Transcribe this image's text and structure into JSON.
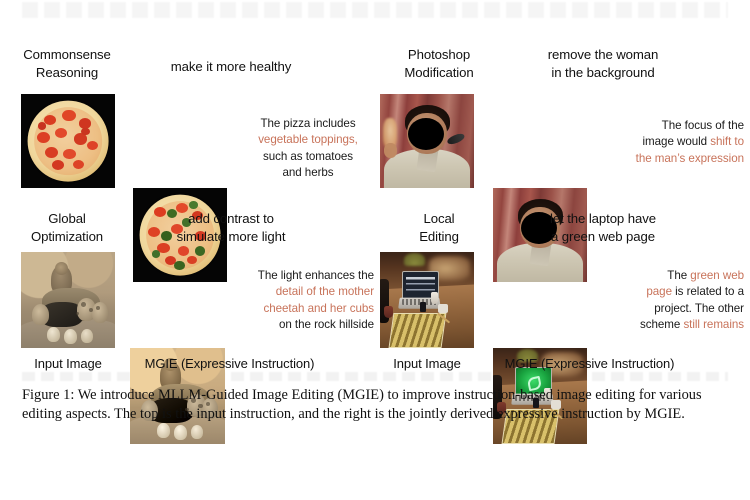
{
  "figure": {
    "panels": [
      {
        "id": "commonsense-reasoning",
        "category": "Commonsense\nReasoning",
        "category_line1": "Commonsense",
        "category_line2": "Reasoning",
        "instruction_line1": "make it more healthy",
        "instruction_line2": "",
        "explanation": [
          {
            "text": "The pizza includes",
            "highlight": false
          },
          {
            "text": "vegetable toppings,",
            "highlight": true
          },
          {
            "text": "such as tomatoes",
            "highlight": false
          },
          {
            "text": "and herbs",
            "highlight": false
          }
        ]
      },
      {
        "id": "photoshop-modification",
        "category_line1": "Photoshop",
        "category_line2": "Modification",
        "instruction_line1": "remove the woman",
        "instruction_line2": "in the background",
        "explanation": [
          {
            "text": "The focus of the",
            "highlight": false
          },
          {
            "text": "image would ",
            "highlight": false,
            "tail": "shift to",
            "tail_highlight": true
          },
          {
            "text": "the man’s expression",
            "highlight": true
          }
        ]
      },
      {
        "id": "global-optimization",
        "category_line1": "Global",
        "category_line2": "Optimization",
        "instruction_line1": "add contrast to",
        "instruction_line2": "simulate more light",
        "explanation": [
          {
            "text": "The light enhances the",
            "highlight": false
          },
          {
            "text": "detail of the mother",
            "highlight": true
          },
          {
            "text": "cheetah and her cubs",
            "highlight": true
          },
          {
            "text": "on the rock hillside",
            "highlight": false
          }
        ]
      },
      {
        "id": "local-editing",
        "category_line1": "Local",
        "category_line2": "Editing",
        "instruction_line1": "let the laptop have",
        "instruction_line2": "a green web page",
        "explanation": [
          {
            "text": "The ",
            "highlight": false,
            "tail": "green web",
            "tail_highlight": true
          },
          {
            "text": "page",
            "highlight": true,
            "tail": " is related to a",
            "tail_highlight": false
          },
          {
            "text": "project. The other",
            "highlight": false
          },
          {
            "text": "scheme ",
            "highlight": false,
            "tail": "still remains",
            "tail_highlight": true
          }
        ]
      }
    ],
    "footer_labels": {
      "input": "Input Image",
      "output": "MGIE (Expressive Instruction)"
    },
    "caption": "Figure 1: We introduce MLLM-Guided Image Editing (MGIE) to improve instruction-based image editing for various editing aspects. The top is the input instruction, and the right is the jointly derived expressive instruction by MGIE.",
    "colors": {
      "highlight": "#c8735a",
      "text": "#111111",
      "background": "#ffffff"
    }
  },
  "expl_html": {
    "p0": "The pizza includes<br><span class=\"hl\">vegetable toppings,</span><br>such as tomatoes<br>and herbs",
    "p1": "The focus of the<br>image would <span class=\"hl\">shift to</span><br><span class=\"hl\">the man’s expression</span>",
    "p2": "The light enhances the<br><span class=\"hl\">detail of the mother</span><br><span class=\"hl\">cheetah and her cubs</span><br>on the rock hillside",
    "p3": "The <span class=\"hl\">green web</span><br><span class=\"hl\">page</span> is related to a<br>project. The other<br>scheme <span class=\"hl\">still remains</span>"
  },
  "image_alts": {
    "pizza_input": "pizza-pepperoni-input-photo",
    "pizza_output": "pizza-with-vegetable-toppings-edited-photo",
    "man_input": "man-with-woman-in-background-input-photo",
    "man_output": "man-woman-removed-edited-photo",
    "cheetah_input": "cheetah-family-input-photo",
    "cheetah_output": "cheetah-family-contrast-enhanced-photo",
    "desk_input": "laptop-on-desk-input-photo",
    "desk_output": "laptop-with-green-screen-edited-photo"
  }
}
